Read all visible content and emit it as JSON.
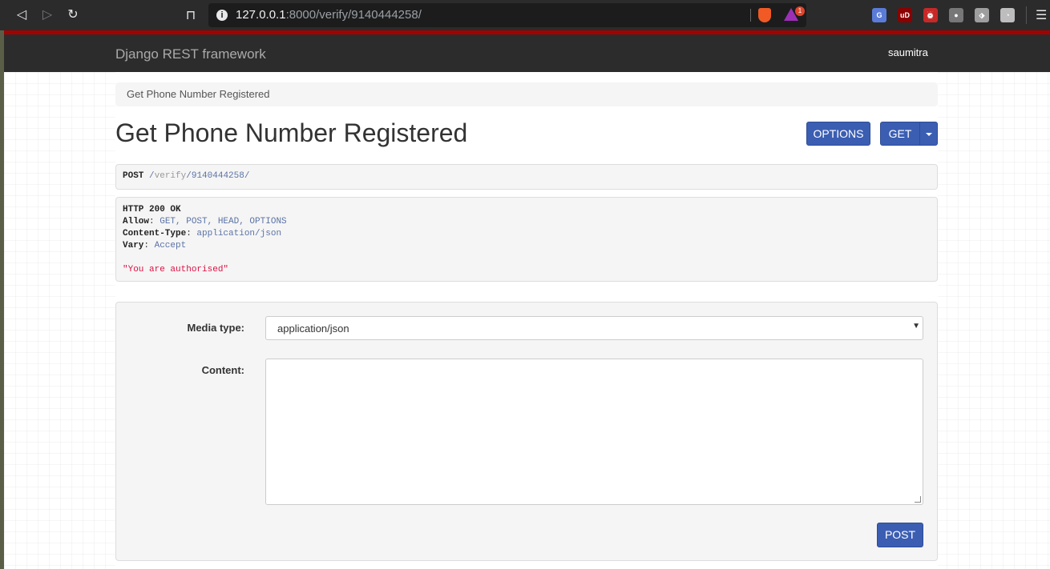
{
  "browser": {
    "url_host": "127.0.0.1",
    "url_rest": ":8000/verify/9140444258/",
    "rewards_badge": "1",
    "extensions": [
      {
        "name": "translate-icon",
        "label": "G",
        "color": "#5a7bd8"
      },
      {
        "name": "ublock-icon",
        "label": "uD",
        "color": "#8b0000"
      },
      {
        "name": "alarm-icon",
        "label": "⏰",
        "color": "#c62828"
      },
      {
        "name": "extension-circle-icon",
        "label": "●",
        "color": "#777777"
      },
      {
        "name": "tag-icon",
        "label": "⬗",
        "color": "#9e9e9e"
      },
      {
        "name": "cookie-icon",
        "label": "◔",
        "color": "#bdbdbd"
      }
    ]
  },
  "navbar": {
    "brand": "Django REST framework",
    "user": "saumitra"
  },
  "breadcrumb": "Get Phone Number Registered",
  "title": "Get Phone Number Registered",
  "buttons": {
    "options": "OPTIONS",
    "get": "GET",
    "post": "POST"
  },
  "request": {
    "method": "POST",
    "path_sep1": "/",
    "path_seg1": "verify",
    "path_sep2": "/",
    "path_seg2": "9140444258",
    "path_sep3": "/"
  },
  "response": {
    "status": "HTTP 200 OK",
    "allow_key": "Allow",
    "allow_val": "GET, POST, HEAD, OPTIONS",
    "ctype_key": "Content-Type",
    "ctype_val": "application/json",
    "vary_key": "Vary",
    "vary_val": "Accept",
    "body": "\"You are authorised\""
  },
  "form": {
    "media_label": "Media type:",
    "media_value": "application/json",
    "content_label": "Content:",
    "content_value": ""
  },
  "colors": {
    "accent": "#3b5eb3",
    "navbar_border": "#a30000",
    "string": "#d14"
  }
}
